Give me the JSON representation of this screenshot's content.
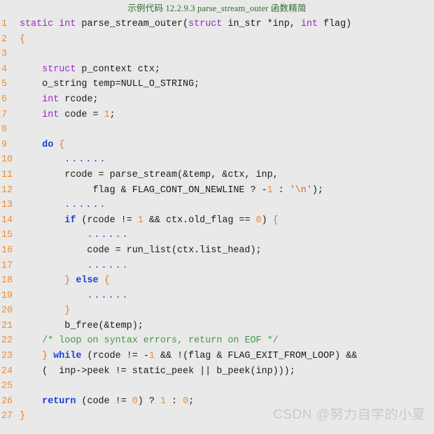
{
  "caption": "示例代码 12.2.9.3 parse_stream_outer 函数精简",
  "watermark": "CSDN @努力自学的小夏",
  "colors": {
    "background": "#e9e9e9",
    "caption_text": "#2e6b2e",
    "line_number": "#f08c2e",
    "keyword_type": "#9a27c4",
    "keyword_control": "#1a3fd6",
    "number": "#f08c2e",
    "string": "#d4691e",
    "comment": "#3f9a3f",
    "brace": "#e07a28",
    "plain_text": "#1a1a1a",
    "watermark_text": "#c9c9c9"
  },
  "code": {
    "language": "c",
    "first_line_number": 1,
    "total_lines": 27,
    "lines": [
      {
        "n": "1",
        "text": "static int parse_stream_outer(struct in_str *inp, int flag)"
      },
      {
        "n": "2",
        "text": "{"
      },
      {
        "n": "3",
        "text": ""
      },
      {
        "n": "4",
        "text": "    struct p_context ctx;"
      },
      {
        "n": "5",
        "text": "    o_string temp=NULL_O_STRING;"
      },
      {
        "n": "6",
        "text": "    int rcode;"
      },
      {
        "n": "7",
        "text": "    int code = 1;"
      },
      {
        "n": "8",
        "text": ""
      },
      {
        "n": "9",
        "text": "    do {"
      },
      {
        "n": "10",
        "text": "        ......"
      },
      {
        "n": "11",
        "text": "        rcode = parse_stream(&temp, &ctx, inp,"
      },
      {
        "n": "12",
        "text": "             flag & FLAG_CONT_ON_NEWLINE ? -1 : '\\n');"
      },
      {
        "n": "13",
        "text": "        ......"
      },
      {
        "n": "14",
        "text": "        if (rcode != 1 && ctx.old_flag == 0) {"
      },
      {
        "n": "15",
        "text": "            ......"
      },
      {
        "n": "16",
        "text": "            code = run_list(ctx.list_head);"
      },
      {
        "n": "17",
        "text": "            ......"
      },
      {
        "n": "18",
        "text": "        } else {"
      },
      {
        "n": "19",
        "text": "            ......"
      },
      {
        "n": "20",
        "text": "        }"
      },
      {
        "n": "21",
        "text": "        b_free(&temp);"
      },
      {
        "n": "22",
        "text": "    /* loop on syntax errors, return on EOF */"
      },
      {
        "n": "23",
        "text": "    } while (rcode != -1 && !(flag & FLAG_EXIT_FROM_LOOP) &&"
      },
      {
        "n": "24",
        "text": "    (  inp->peek != static_peek || b_peek(inp)));"
      },
      {
        "n": "25",
        "text": ""
      },
      {
        "n": "26",
        "text": "    return (code != 0) ? 1 : 0;"
      },
      {
        "n": "27",
        "text": "}"
      }
    ],
    "tokens": [
      [
        {
          "t": "static",
          "c": "kw"
        },
        {
          "t": " ",
          "c": "plain"
        },
        {
          "t": "int",
          "c": "kw"
        },
        {
          "t": " parse_stream_outer(",
          "c": "plain"
        },
        {
          "t": "struct",
          "c": "kw"
        },
        {
          "t": " in_str *inp, ",
          "c": "plain"
        },
        {
          "t": "int",
          "c": "kw"
        },
        {
          "t": " flag)",
          "c": "plain"
        }
      ],
      [
        {
          "t": "{",
          "c": "brace"
        }
      ],
      [
        {
          "t": "",
          "c": "plain"
        }
      ],
      [
        {
          "t": "    ",
          "c": "plain"
        },
        {
          "t": "struct",
          "c": "kw"
        },
        {
          "t": " p_context ctx;",
          "c": "plain"
        }
      ],
      [
        {
          "t": "    o_string temp=NULL_O_STRING;",
          "c": "plain"
        }
      ],
      [
        {
          "t": "    ",
          "c": "plain"
        },
        {
          "t": "int",
          "c": "kw"
        },
        {
          "t": " rcode;",
          "c": "plain"
        }
      ],
      [
        {
          "t": "    ",
          "c": "plain"
        },
        {
          "t": "int",
          "c": "kw"
        },
        {
          "t": " code = ",
          "c": "plain"
        },
        {
          "t": "1",
          "c": "num"
        },
        {
          "t": ";",
          "c": "plain"
        }
      ],
      [
        {
          "t": "",
          "c": "plain"
        }
      ],
      [
        {
          "t": "    ",
          "c": "plain"
        },
        {
          "t": "do",
          "c": "ctl"
        },
        {
          "t": " ",
          "c": "plain"
        },
        {
          "t": "{",
          "c": "brace"
        }
      ],
      [
        {
          "t": "        ",
          "c": "plain"
        },
        {
          "t": "......",
          "c": "dots"
        }
      ],
      [
        {
          "t": "        rcode = parse_stream(&temp, &ctx, inp,",
          "c": "plain"
        }
      ],
      [
        {
          "t": "             flag & FLAG_CONT_ON_NEWLINE ? -",
          "c": "plain"
        },
        {
          "t": "1",
          "c": "num"
        },
        {
          "t": " : ",
          "c": "plain"
        },
        {
          "t": "'\\n'",
          "c": "str"
        },
        {
          "t": ");",
          "c": "plain"
        }
      ],
      [
        {
          "t": "        ",
          "c": "plain"
        },
        {
          "t": "......",
          "c": "dots"
        }
      ],
      [
        {
          "t": "        ",
          "c": "plain"
        },
        {
          "t": "if",
          "c": "ctl"
        },
        {
          "t": " (rcode != ",
          "c": "plain"
        },
        {
          "t": "1",
          "c": "num"
        },
        {
          "t": " && ctx.old_flag == ",
          "c": "plain"
        },
        {
          "t": "0",
          "c": "num"
        },
        {
          "t": ") ",
          "c": "plain"
        },
        {
          "t": "{",
          "c": "brace"
        }
      ],
      [
        {
          "t": "            ",
          "c": "plain"
        },
        {
          "t": "......",
          "c": "dots"
        }
      ],
      [
        {
          "t": "            code = run_list(ctx.list_head);",
          "c": "plain"
        }
      ],
      [
        {
          "t": "            ",
          "c": "plain"
        },
        {
          "t": "......",
          "c": "dots"
        }
      ],
      [
        {
          "t": "        ",
          "c": "plain"
        },
        {
          "t": "}",
          "c": "brace"
        },
        {
          "t": " ",
          "c": "plain"
        },
        {
          "t": "else",
          "c": "ctl"
        },
        {
          "t": " ",
          "c": "plain"
        },
        {
          "t": "{",
          "c": "brace"
        }
      ],
      [
        {
          "t": "            ",
          "c": "plain"
        },
        {
          "t": "......",
          "c": "dots"
        }
      ],
      [
        {
          "t": "        ",
          "c": "plain"
        },
        {
          "t": "}",
          "c": "brace"
        }
      ],
      [
        {
          "t": "        b_free(&temp);",
          "c": "plain"
        }
      ],
      [
        {
          "t": "    ",
          "c": "plain"
        },
        {
          "t": "/* loop on syntax errors, return on EOF */",
          "c": "cmt"
        }
      ],
      [
        {
          "t": "    ",
          "c": "plain"
        },
        {
          "t": "}",
          "c": "brace"
        },
        {
          "t": " ",
          "c": "plain"
        },
        {
          "t": "while",
          "c": "ctl"
        },
        {
          "t": " (rcode != -",
          "c": "plain"
        },
        {
          "t": "1",
          "c": "num"
        },
        {
          "t": " && !(flag & FLAG_EXIT_FROM_LOOP) &&",
          "c": "plain"
        }
      ],
      [
        {
          "t": "    (  inp->peek != static_peek || b_peek(inp)));",
          "c": "plain"
        }
      ],
      [
        {
          "t": "",
          "c": "plain"
        }
      ],
      [
        {
          "t": "    ",
          "c": "plain"
        },
        {
          "t": "return",
          "c": "ctl"
        },
        {
          "t": " (code != ",
          "c": "plain"
        },
        {
          "t": "0",
          "c": "num"
        },
        {
          "t": ") ? ",
          "c": "plain"
        },
        {
          "t": "1",
          "c": "num"
        },
        {
          "t": " : ",
          "c": "plain"
        },
        {
          "t": "0",
          "c": "num"
        },
        {
          "t": ";",
          "c": "plain"
        }
      ],
      [
        {
          "t": "}",
          "c": "brace"
        }
      ]
    ]
  }
}
